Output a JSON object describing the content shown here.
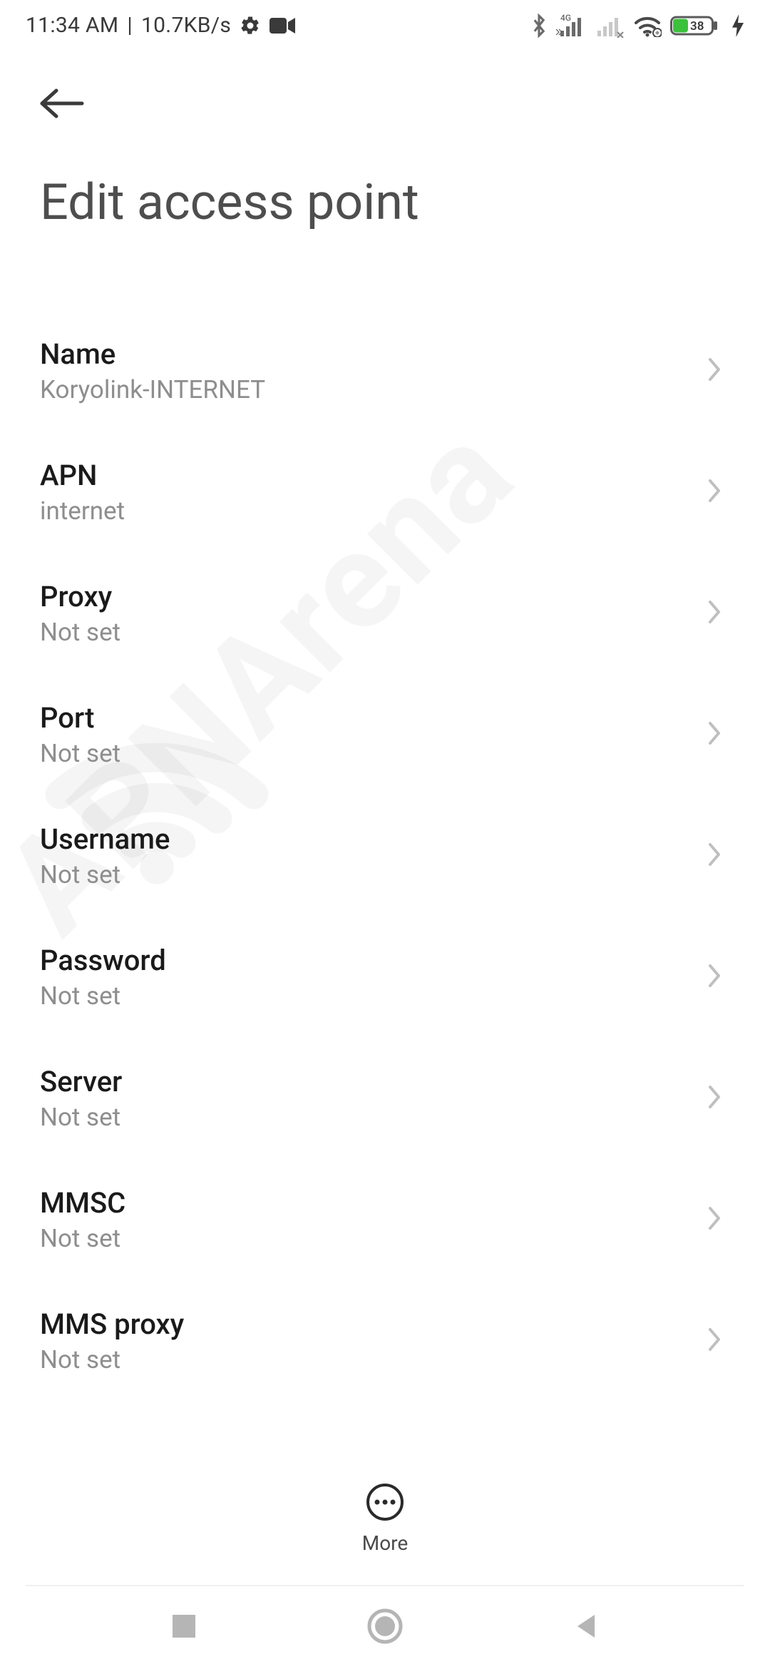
{
  "status_bar": {
    "time": "11:34 AM",
    "separator": " | ",
    "data_rate": "10.7KB/s",
    "network_label": "4G",
    "battery_percent": "38"
  },
  "header": {
    "title": "Edit access point"
  },
  "settings": [
    {
      "label": "Name",
      "value": "Koryolink-INTERNET"
    },
    {
      "label": "APN",
      "value": "internet"
    },
    {
      "label": "Proxy",
      "value": "Not set"
    },
    {
      "label": "Port",
      "value": "Not set"
    },
    {
      "label": "Username",
      "value": "Not set"
    },
    {
      "label": "Password",
      "value": "Not set"
    },
    {
      "label": "Server",
      "value": "Not set"
    },
    {
      "label": "MMSC",
      "value": "Not set"
    },
    {
      "label": "MMS proxy",
      "value": "Not set"
    }
  ],
  "more": {
    "label": "More"
  },
  "watermark": {
    "text": "APNArena"
  }
}
